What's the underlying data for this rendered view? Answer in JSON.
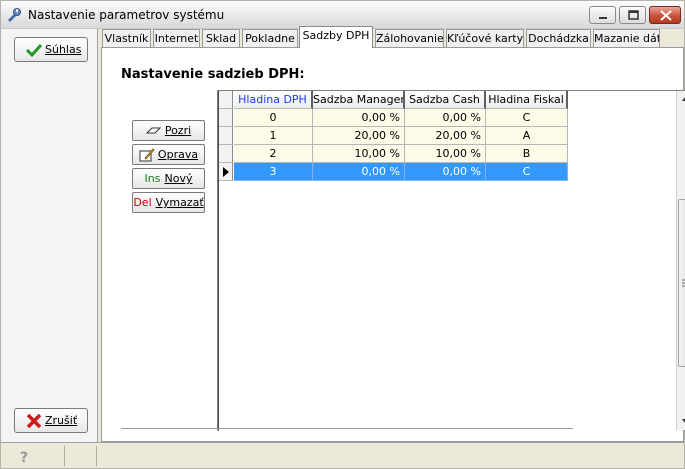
{
  "window": {
    "title": "Nastavenie parametrov systému"
  },
  "sidebar": {
    "ok_label": "Súhlas",
    "cancel_label": "Zrušiť"
  },
  "tabs": [
    {
      "label": "Vlastník"
    },
    {
      "label": "Internet"
    },
    {
      "label": "Sklad"
    },
    {
      "label": "Pokladne"
    },
    {
      "label": "Sadzby DPH",
      "active": true
    },
    {
      "label": "Zálohovanie"
    },
    {
      "label": "Kľúčové karty"
    },
    {
      "label": "Dochádzka"
    },
    {
      "label": "Mazanie dát"
    }
  ],
  "section": {
    "title": "Nastavenie sadzieb DPH:"
  },
  "actions": {
    "view_label": "Pozri",
    "edit_label": "Oprava",
    "new_key": "Ins",
    "new_label": "Nový",
    "delete_key": "Del",
    "delete_label": "Vymazať"
  },
  "grid": {
    "columns": [
      "Hladina DPH",
      "Sadzba Manager",
      "Sadzba Cash",
      "Hladina Fiskal"
    ],
    "rows": [
      {
        "level": "0",
        "manager": "0,00 %",
        "cash": "0,00 %",
        "fiskal": "C"
      },
      {
        "level": "1",
        "manager": "20,00 %",
        "cash": "20,00 %",
        "fiskal": "A"
      },
      {
        "level": "2",
        "manager": "10,00 %",
        "cash": "10,00 %",
        "fiskal": "B"
      },
      {
        "level": "3",
        "manager": "0,00 %",
        "cash": "0,00 %",
        "fiskal": "C"
      }
    ],
    "selected_row": 3
  },
  "colors": {
    "selection": "#3399ff",
    "row_bg": "#fdfbe8",
    "header_first": "#1c3fe0"
  },
  "icons": {
    "app": "wrench-icon",
    "ok": "check-icon",
    "cancel": "x-icon",
    "view": "glasses-icon",
    "edit": "pencil-icon",
    "help": "help-icon"
  }
}
